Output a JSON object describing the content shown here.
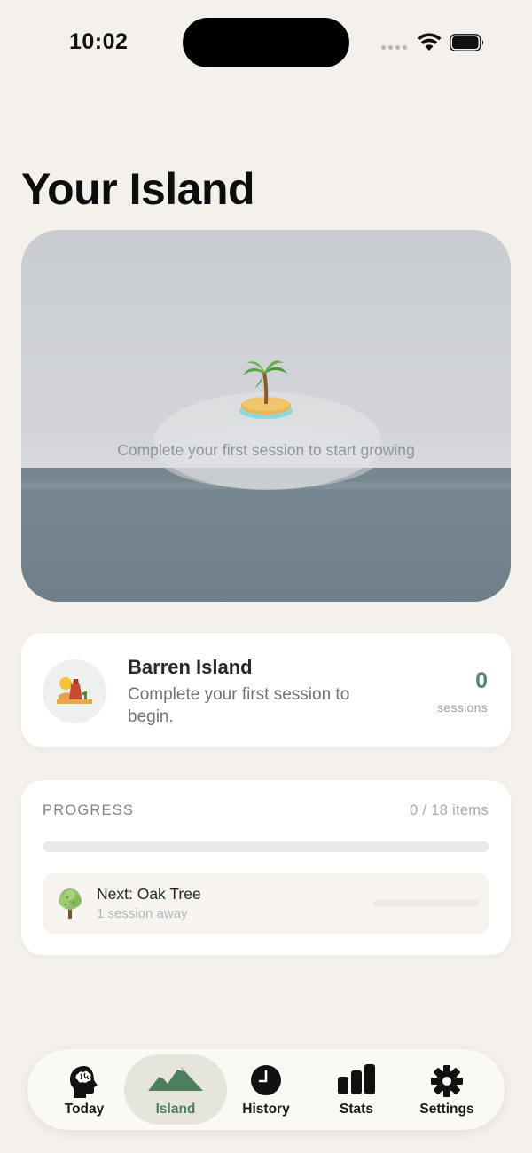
{
  "status_bar": {
    "time": "10:02"
  },
  "page": {
    "title": "Your Island"
  },
  "island_scene": {
    "hint": "Complete your first session to start growing",
    "icon": "desert-island-icon"
  },
  "stage": {
    "icon": "desert-icon",
    "name": "Barren Island",
    "description": "Complete your first session to begin.",
    "session_count": "0",
    "session_label": "sessions"
  },
  "progress": {
    "label": "PROGRESS",
    "count": "0 / 18 items",
    "fraction": 0,
    "next": {
      "icon": "tree-icon",
      "title": "Next: Oak Tree",
      "subtitle": "1 session away",
      "fraction": 0
    }
  },
  "tabs": [
    {
      "label": "Today",
      "icon": "brain-head-icon",
      "active": false
    },
    {
      "label": "Island",
      "icon": "mountains-icon",
      "active": true
    },
    {
      "label": "History",
      "icon": "clock-icon",
      "active": false
    },
    {
      "label": "Stats",
      "icon": "bar-chart-icon",
      "active": false
    },
    {
      "label": "Settings",
      "icon": "gear-icon",
      "active": false
    }
  ],
  "colors": {
    "background": "#f4f1ec",
    "accent_green": "#4f8a6b",
    "active_tab": "#e5e5dc"
  }
}
